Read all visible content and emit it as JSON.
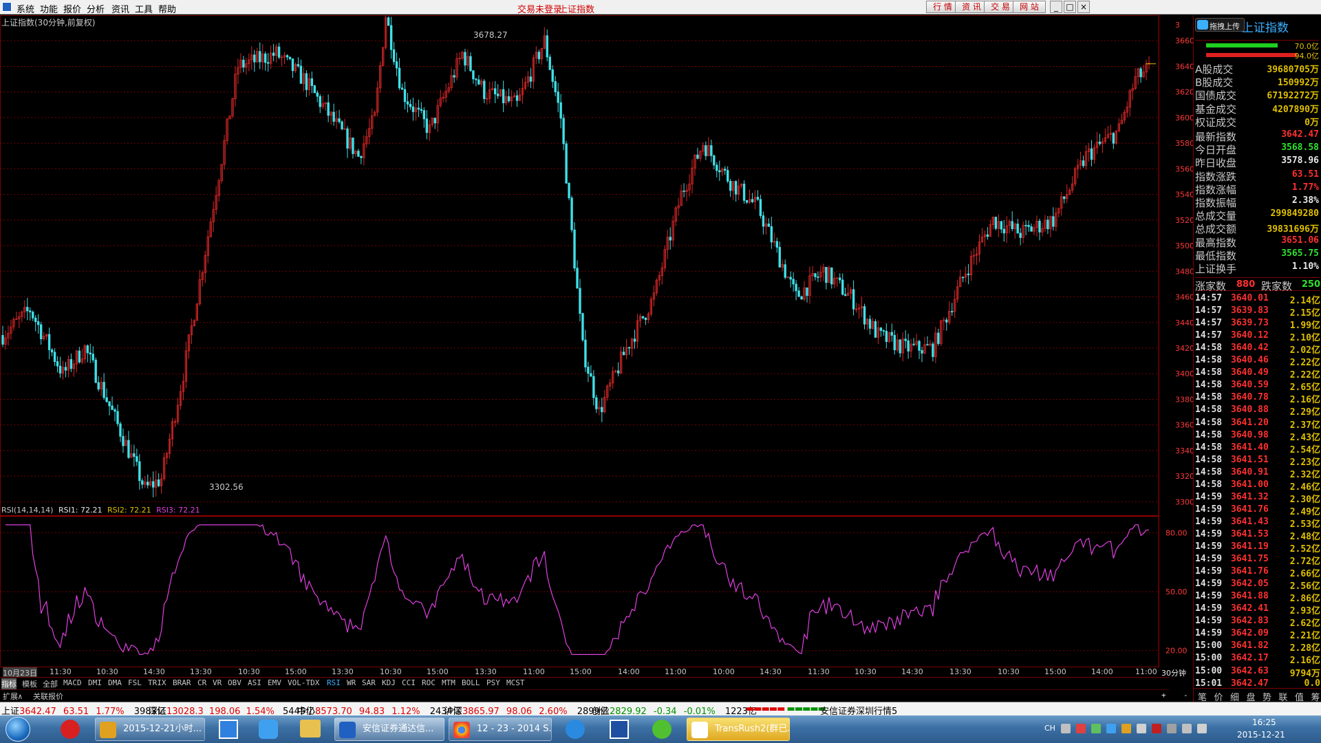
{
  "menubar": {
    "items": [
      "系统",
      "功能",
      "报价",
      "分析",
      "资讯",
      "工具",
      "帮助"
    ],
    "status_login": "交易未登录",
    "status_index": "上证指数",
    "right_buttons": [
      "行 情",
      "资 讯",
      "交 易",
      "网 站"
    ],
    "window_controls": [
      "_",
      "□",
      "×"
    ]
  },
  "main_chart": {
    "title": "上证指数(30分钟,前复权)",
    "high_label": "3678.27",
    "low_label": "3302.56",
    "price_axis": [
      "3660",
      "3640",
      "3620",
      "3600",
      "3580",
      "3560",
      "3540",
      "3520",
      "3500",
      "3480",
      "3460",
      "3440",
      "3420",
      "3400",
      "3380",
      "3360",
      "3340",
      "3320",
      "3300"
    ],
    "price_top_label": "3"
  },
  "rsi_panel": {
    "title": "RSI(14,14,14)",
    "rsi1": "RSI1: 72.21",
    "rsi2": "RSI2: 72.21",
    "rsi3": "RSI3: 72.21",
    "axis": [
      "80.00",
      "50.00",
      "20.00"
    ]
  },
  "time_axis": [
    "10月23日",
    "11:30",
    "10:30",
    "14:30",
    "13:30",
    "10:30",
    "15:00",
    "13:30",
    "10:30",
    "15:00",
    "13:30",
    "11:00",
    "15:00",
    "14:00",
    "11:00",
    "10:00",
    "14:30",
    "11:30",
    "10:30",
    "14:30",
    "13:30",
    "10:30",
    "15:00",
    "14:00",
    "11:00"
  ],
  "period_label": "30分钟",
  "indicator_tabs": [
    "指标",
    "模板",
    "全部",
    "MACD",
    "DMI",
    "DMA",
    "FSL",
    "TRIX",
    "BRAR",
    "CR",
    "VR",
    "OBV",
    "ASI",
    "EMV",
    "VOL-TDX",
    "RSI",
    "WR",
    "SAR",
    "KDJ",
    "CCI",
    "ROC",
    "MTM",
    "BOLL",
    "PSY",
    "MCST"
  ],
  "ext_tabs": [
    "扩展∧",
    "关联报价"
  ],
  "sidebar": {
    "upload_btn": "拖拽上传",
    "title": "上证指数",
    "bar_vals": [
      "70.0亿",
      "94.0亿"
    ],
    "stats": [
      {
        "label": "A股成交",
        "value": "39680705万",
        "color": "#e0c000"
      },
      {
        "label": "B股成交",
        "value": "150992万",
        "color": "#e0c000"
      },
      {
        "label": "国债成交",
        "value": "67192272万",
        "color": "#e0c000"
      },
      {
        "label": "基金成交",
        "value": "4207890万",
        "color": "#e0c000"
      },
      {
        "label": "权证成交",
        "value": "0万",
        "color": "#e0c000"
      },
      {
        "label": "最新指数",
        "value": "3642.47",
        "color": "#ff3030"
      },
      {
        "label": "今日开盘",
        "value": "3568.58",
        "color": "#30e030"
      },
      {
        "label": "昨日收盘",
        "value": "3578.96",
        "color": "#e8e8e8"
      },
      {
        "label": "指数涨跌",
        "value": "63.51",
        "color": "#ff3030"
      },
      {
        "label": "指数涨幅",
        "value": "1.77%",
        "color": "#ff3030"
      },
      {
        "label": "指数振幅",
        "value": "2.38%",
        "color": "#e8e8e8"
      },
      {
        "label": "总成交量",
        "value": "299849280",
        "color": "#e0c000"
      },
      {
        "label": "总成交额",
        "value": "39831696万",
        "color": "#e0c000"
      },
      {
        "label": "最高指数",
        "value": "3651.06",
        "color": "#ff3030"
      },
      {
        "label": "最低指数",
        "value": "3565.75",
        "color": "#30e030"
      },
      {
        "label": "上证换手",
        "value": "1.10%",
        "color": "#e8e8e8"
      }
    ],
    "updown": {
      "up_label": "涨家数",
      "up": "880",
      "down_label": "跌家数",
      "down": "250"
    },
    "ticks": [
      [
        "14:57",
        "3640.01",
        "2.14亿"
      ],
      [
        "14:57",
        "3639.83",
        "2.15亿"
      ],
      [
        "14:57",
        "3639.73",
        "1.99亿"
      ],
      [
        "14:57",
        "3640.12",
        "2.10亿"
      ],
      [
        "14:58",
        "3640.42",
        "2.02亿"
      ],
      [
        "14:58",
        "3640.46",
        "2.22亿"
      ],
      [
        "14:58",
        "3640.49",
        "2.22亿"
      ],
      [
        "14:58",
        "3640.59",
        "2.65亿"
      ],
      [
        "14:58",
        "3640.78",
        "2.16亿"
      ],
      [
        "14:58",
        "3640.88",
        "2.29亿"
      ],
      [
        "14:58",
        "3641.20",
        "2.37亿"
      ],
      [
        "14:58",
        "3640.98",
        "2.43亿"
      ],
      [
        "14:58",
        "3641.40",
        "2.54亿"
      ],
      [
        "14:58",
        "3641.51",
        "2.23亿"
      ],
      [
        "14:58",
        "3640.91",
        "2.32亿"
      ],
      [
        "14:58",
        "3641.00",
        "2.46亿"
      ],
      [
        "14:59",
        "3641.32",
        "2.30亿"
      ],
      [
        "14:59",
        "3641.76",
        "2.49亿"
      ],
      [
        "14:59",
        "3641.43",
        "2.53亿"
      ],
      [
        "14:59",
        "3641.53",
        "2.48亿"
      ],
      [
        "14:59",
        "3641.19",
        "2.52亿"
      ],
      [
        "14:59",
        "3641.75",
        "2.72亿"
      ],
      [
        "14:59",
        "3641.76",
        "2.66亿"
      ],
      [
        "14:59",
        "3642.05",
        "2.56亿"
      ],
      [
        "14:59",
        "3641.88",
        "2.86亿"
      ],
      [
        "14:59",
        "3642.41",
        "2.93亿"
      ],
      [
        "14:59",
        "3642.83",
        "2.62亿"
      ],
      [
        "14:59",
        "3642.09",
        "2.21亿"
      ],
      [
        "15:00",
        "3641.82",
        "2.28亿"
      ],
      [
        "15:00",
        "3642.17",
        "2.16亿"
      ],
      [
        "15:00",
        "3642.63",
        "9794万"
      ],
      [
        "15:01",
        "3642.47",
        "0.0"
      ]
    ],
    "tabs": [
      "笔",
      "价",
      "细",
      "盘",
      "势",
      "联",
      "值",
      "筹"
    ]
  },
  "ticker": {
    "sh_label": "上证",
    "sh_val": "3642.47",
    "sh_chg": "63.51",
    "sh_pct": "1.77%",
    "sh_amt": "3983亿",
    "sz_label": "深证",
    "sz_val": "13028.3",
    "sz_chg": "198.06",
    "sz_pct": "1.54%",
    "sz_amt": "5445亿",
    "zx_label": "中小",
    "zx_val": "8573.70",
    "zx_chg": "94.83",
    "zx_pct": "1.12%",
    "zx_amt": "2434亿",
    "hs_label": "沪深",
    "hs_val": "3865.97",
    "hs_chg": "98.06",
    "hs_pct": "2.60%",
    "hs_amt": "2899亿",
    "cy_label": "创业",
    "cy_val": "2829.92",
    "cy_chg": "-0.34",
    "cy_pct": "-0.01%",
    "cy_amt": "1223亿",
    "server": "安信证券深圳行情5"
  },
  "taskbar": {
    "buttons": [
      "2015-12-21小时...",
      "",
      "",
      "",
      "安信证券通达信...",
      "12 - 23 - 2014 S...",
      "",
      "",
      "",
      "TransRush2(群已..."
    ],
    "lang": "CH",
    "time": "16:25",
    "date": "2015-12-21"
  },
  "colors": {
    "up": "#d82828",
    "down": "#40e0e8",
    "rsi": "#e040e0",
    "grid": "#7a0000"
  }
}
